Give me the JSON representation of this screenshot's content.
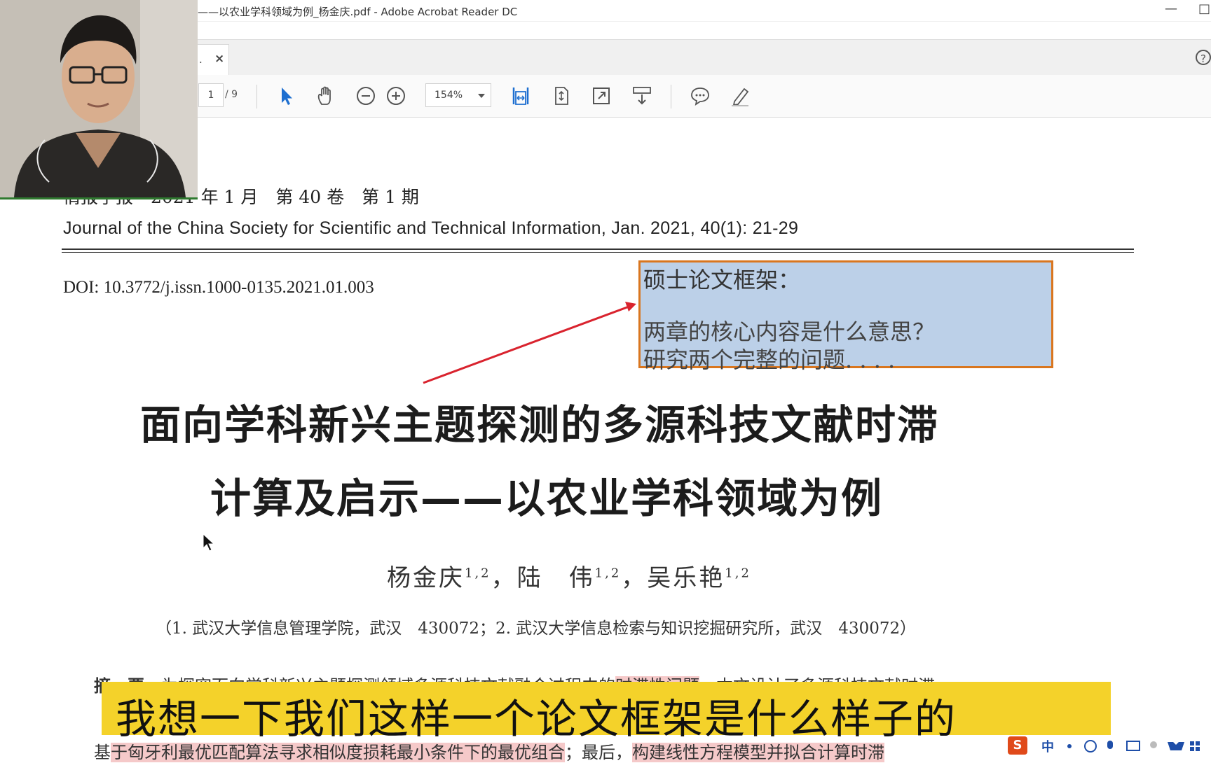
{
  "window": {
    "title": "——以农业学科领域为例_杨金庆.pdf - Adobe Acrobat Reader DC",
    "minimize_glyph": "—",
    "restore_glyph": "□"
  },
  "tab": {
    "label": ".",
    "close_glyph": "×",
    "help_glyph": "?"
  },
  "toolbar": {
    "page_current": "1",
    "page_total": "/ 9",
    "zoom": "154%",
    "icons": [
      "select-arrow-icon",
      "hand-icon",
      "zoom-out-icon",
      "zoom-in-icon",
      "fit-width-icon",
      "fit-page-icon",
      "full-screen-icon",
      "scroll-mode-icon",
      "comment-icon",
      "highlight-pen-icon"
    ]
  },
  "document": {
    "journal_cn": "情报学报　2021 年 1 月　第 40 卷　第 1 期",
    "journal_en": "Journal of the China Society for Scientific and Technical Information, Jan. 2021, 40(1): 21-29",
    "doi": "DOI: 10.3772/j.issn.1000-0135.2021.01.003",
    "title_line1": "面向学科新兴主题探测的多源科技文献时滞",
    "title_line2": "计算及启示——以农业学科领域为例",
    "author1": "杨金庆",
    "author2": "陆　伟",
    "author3": "吴乐艳",
    "author_sup": "1,2",
    "author_sep": "，",
    "affiliation": "（1. 武汉大学信息管理学院，武汉　430072；2. 武汉大学信息检索与知识挖掘研究所，武汉　430072）",
    "abstract_label": "摘　要",
    "abstract_line1_a": "为探究面向学科新兴主题探测领域多源科技文献融合过程中的",
    "abstract_line1_hl": "时滞性问题",
    "abstract_line1_b": "，本文设计了多源科技文献时滞",
    "abstract_line3_a": "基",
    "abstract_line3_hl": "于匈牙利最优匹配算法寻求相似度损耗最小条件下的最优组合",
    "abstract_line3_b": "；最后，",
    "abstract_line3_hl2": "构建线性方程模型并拟合计算时滞"
  },
  "annotation": {
    "title": "硕士论文框架：",
    "line1": "两章的核心内容是什么意思？",
    "line2": "研究两个完整的问题. . . ."
  },
  "subtitle": {
    "text": "我想一下我们这样一个论文框架是什么样子的"
  },
  "ime": {
    "logo": "S",
    "mode": "中"
  },
  "colors": {
    "annotation_fill": "#bcd0e8",
    "annotation_border": "#d9761f",
    "arrow": "#d9232e",
    "subtitle_bg": "#f4d22a",
    "toolbar_icon": "#1e6fd0",
    "highlight": "#f5c9c9"
  }
}
